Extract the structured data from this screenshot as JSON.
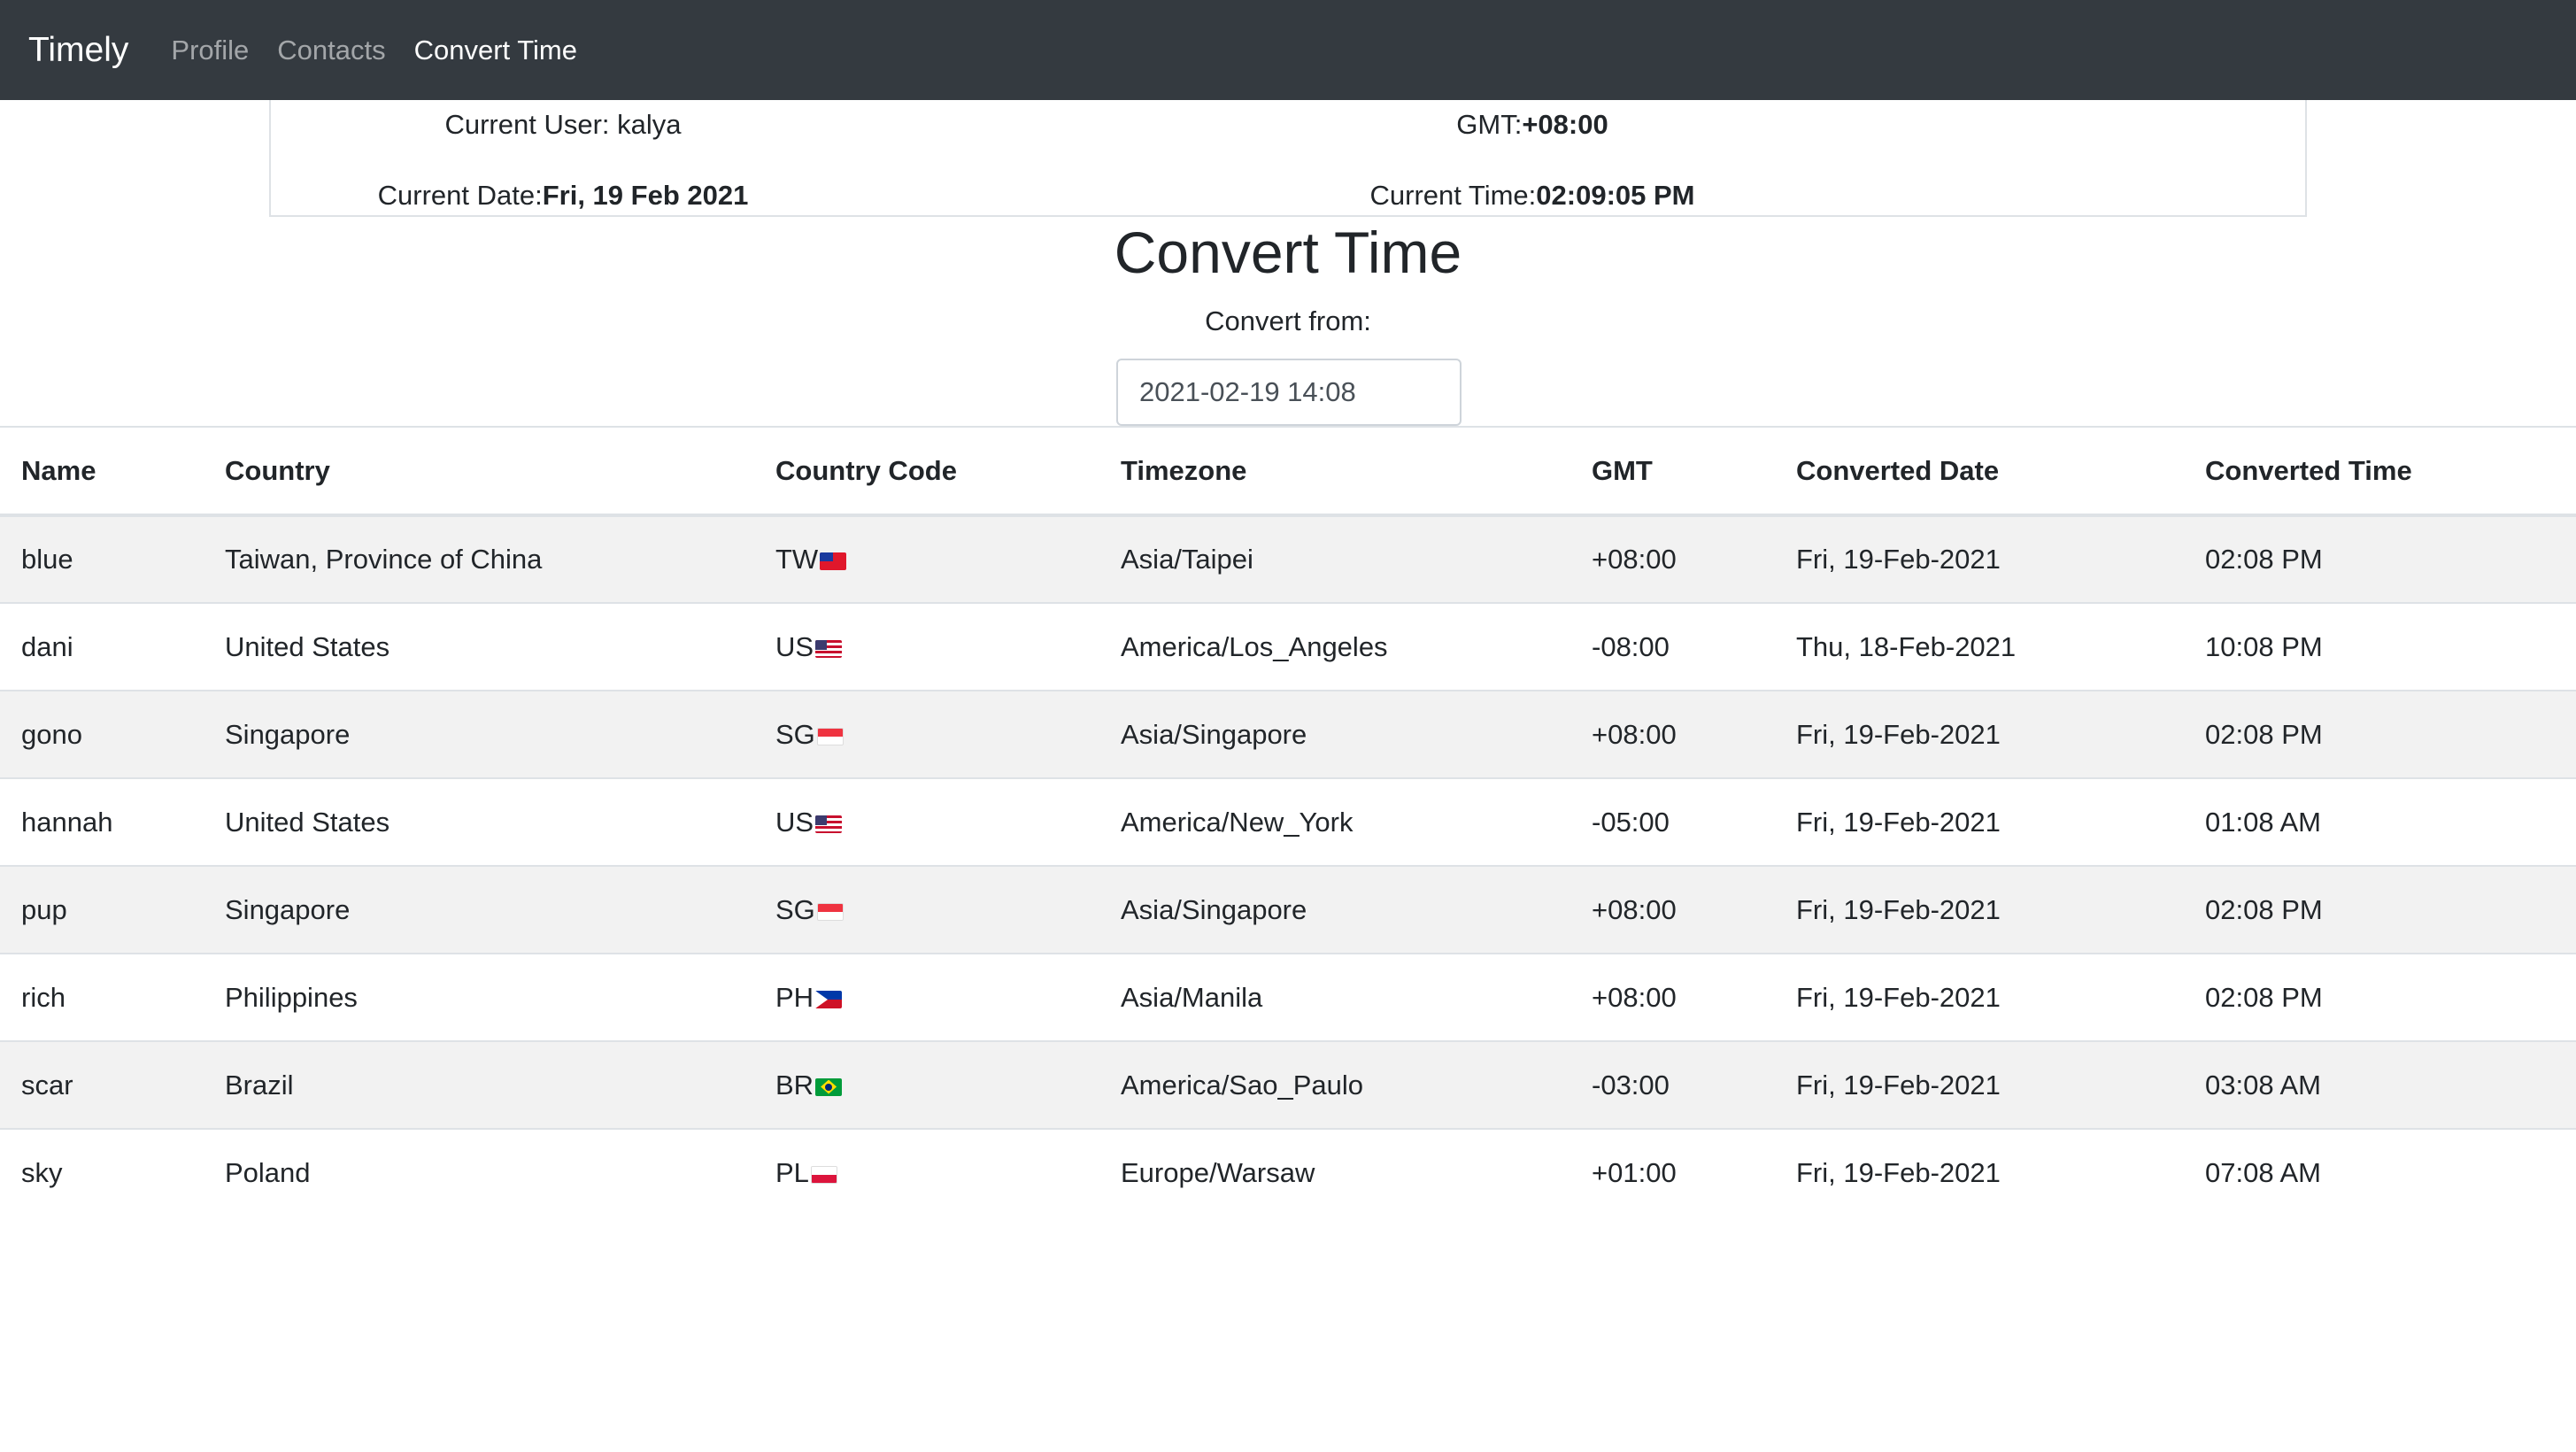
{
  "navbar": {
    "brand": "Timely",
    "links": [
      {
        "label": "Profile"
      },
      {
        "label": "Contacts"
      },
      {
        "label": "Convert Time"
      }
    ]
  },
  "info": {
    "user_label": "Current User: ",
    "user_value": "kalya",
    "gmt_label": "GMT:",
    "gmt_value": "+08:00",
    "date_label": "Current Date:",
    "date_value": "Fri, 19 Feb 2021",
    "time_label": "Current Time:",
    "time_value": "02:09:05 PM"
  },
  "page": {
    "title": "Convert Time",
    "convert_from_label": "Convert from:",
    "convert_from_value": "2021-02-19 14:08"
  },
  "table": {
    "headers": [
      "Name",
      "Country",
      "Country Code",
      "Timezone",
      "GMT",
      "Converted Date",
      "Converted Time"
    ],
    "rows": [
      {
        "name": "blue",
        "country": "Taiwan, Province of China",
        "code": "TW",
        "flag": "flag-tw",
        "timezone": "Asia/Taipei",
        "gmt": "+08:00",
        "date": "Fri, 19-Feb-2021",
        "time": "02:08 PM"
      },
      {
        "name": "dani",
        "country": "United States",
        "code": "US",
        "flag": "flag-us",
        "timezone": "America/Los_Angeles",
        "gmt": "-08:00",
        "date": "Thu, 18-Feb-2021",
        "time": "10:08 PM"
      },
      {
        "name": "gono",
        "country": "Singapore",
        "code": "SG",
        "flag": "flag-sg",
        "timezone": "Asia/Singapore",
        "gmt": "+08:00",
        "date": "Fri, 19-Feb-2021",
        "time": "02:08 PM"
      },
      {
        "name": "hannah",
        "country": "United States",
        "code": "US",
        "flag": "flag-us",
        "timezone": "America/New_York",
        "gmt": "-05:00",
        "date": "Fri, 19-Feb-2021",
        "time": "01:08 AM"
      },
      {
        "name": "pup",
        "country": "Singapore",
        "code": "SG",
        "flag": "flag-sg",
        "timezone": "Asia/Singapore",
        "gmt": "+08:00",
        "date": "Fri, 19-Feb-2021",
        "time": "02:08 PM"
      },
      {
        "name": "rich",
        "country": "Philippines",
        "code": "PH",
        "flag": "flag-ph",
        "timezone": "Asia/Manila",
        "gmt": "+08:00",
        "date": "Fri, 19-Feb-2021",
        "time": "02:08 PM"
      },
      {
        "name": "scar",
        "country": "Brazil",
        "code": "BR",
        "flag": "flag-br",
        "timezone": "America/Sao_Paulo",
        "gmt": "-03:00",
        "date": "Fri, 19-Feb-2021",
        "time": "03:08 AM"
      },
      {
        "name": "sky",
        "country": "Poland",
        "code": "PL",
        "flag": "flag-pl",
        "timezone": "Europe/Warsaw",
        "gmt": "+01:00",
        "date": "Fri, 19-Feb-2021",
        "time": "07:08 AM"
      }
    ]
  }
}
